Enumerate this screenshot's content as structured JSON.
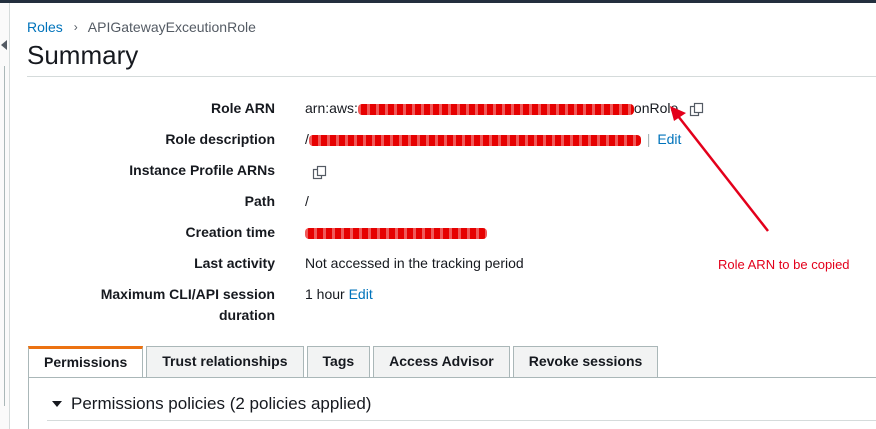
{
  "breadcrumb": {
    "root": "Roles",
    "current": "APIGatewayExceutionRole"
  },
  "page": {
    "title": "Summary"
  },
  "summary": {
    "role_arn": {
      "label": "Role ARN",
      "prefix": "arn:aws:",
      "suffix": "onRole"
    },
    "role_description": {
      "label": "Role description",
      "prefix": "/",
      "edit": "Edit"
    },
    "instance_profile_arns": {
      "label": "Instance Profile ARNs"
    },
    "path": {
      "label": "Path",
      "value": "/"
    },
    "creation_time": {
      "label": "Creation time"
    },
    "last_activity": {
      "label": "Last activity",
      "value": "Not accessed in the tracking period"
    },
    "max_session": {
      "label_line1": "Maximum CLI/API session",
      "label_line2": "duration",
      "value": "1 hour",
      "edit": "Edit"
    }
  },
  "annotation": {
    "text": "Role ARN to be copied",
    "color": "#e3001b"
  },
  "tabs": [
    {
      "label": "Permissions",
      "active": true
    },
    {
      "label": "Trust relationships",
      "active": false
    },
    {
      "label": "Tags",
      "active": false
    },
    {
      "label": "Access Advisor",
      "active": false
    },
    {
      "label": "Revoke sessions",
      "active": false
    }
  ],
  "permissions": {
    "section_title": "Permissions policies (2 policies applied)"
  },
  "icons": {
    "copy": "copy-icon",
    "caret": "caret-down-icon",
    "breadcrumb_sep": "chevron-right-icon"
  },
  "colors": {
    "link": "#0073bb",
    "active_tab": "#ec7211",
    "redaction": "#e60000"
  }
}
